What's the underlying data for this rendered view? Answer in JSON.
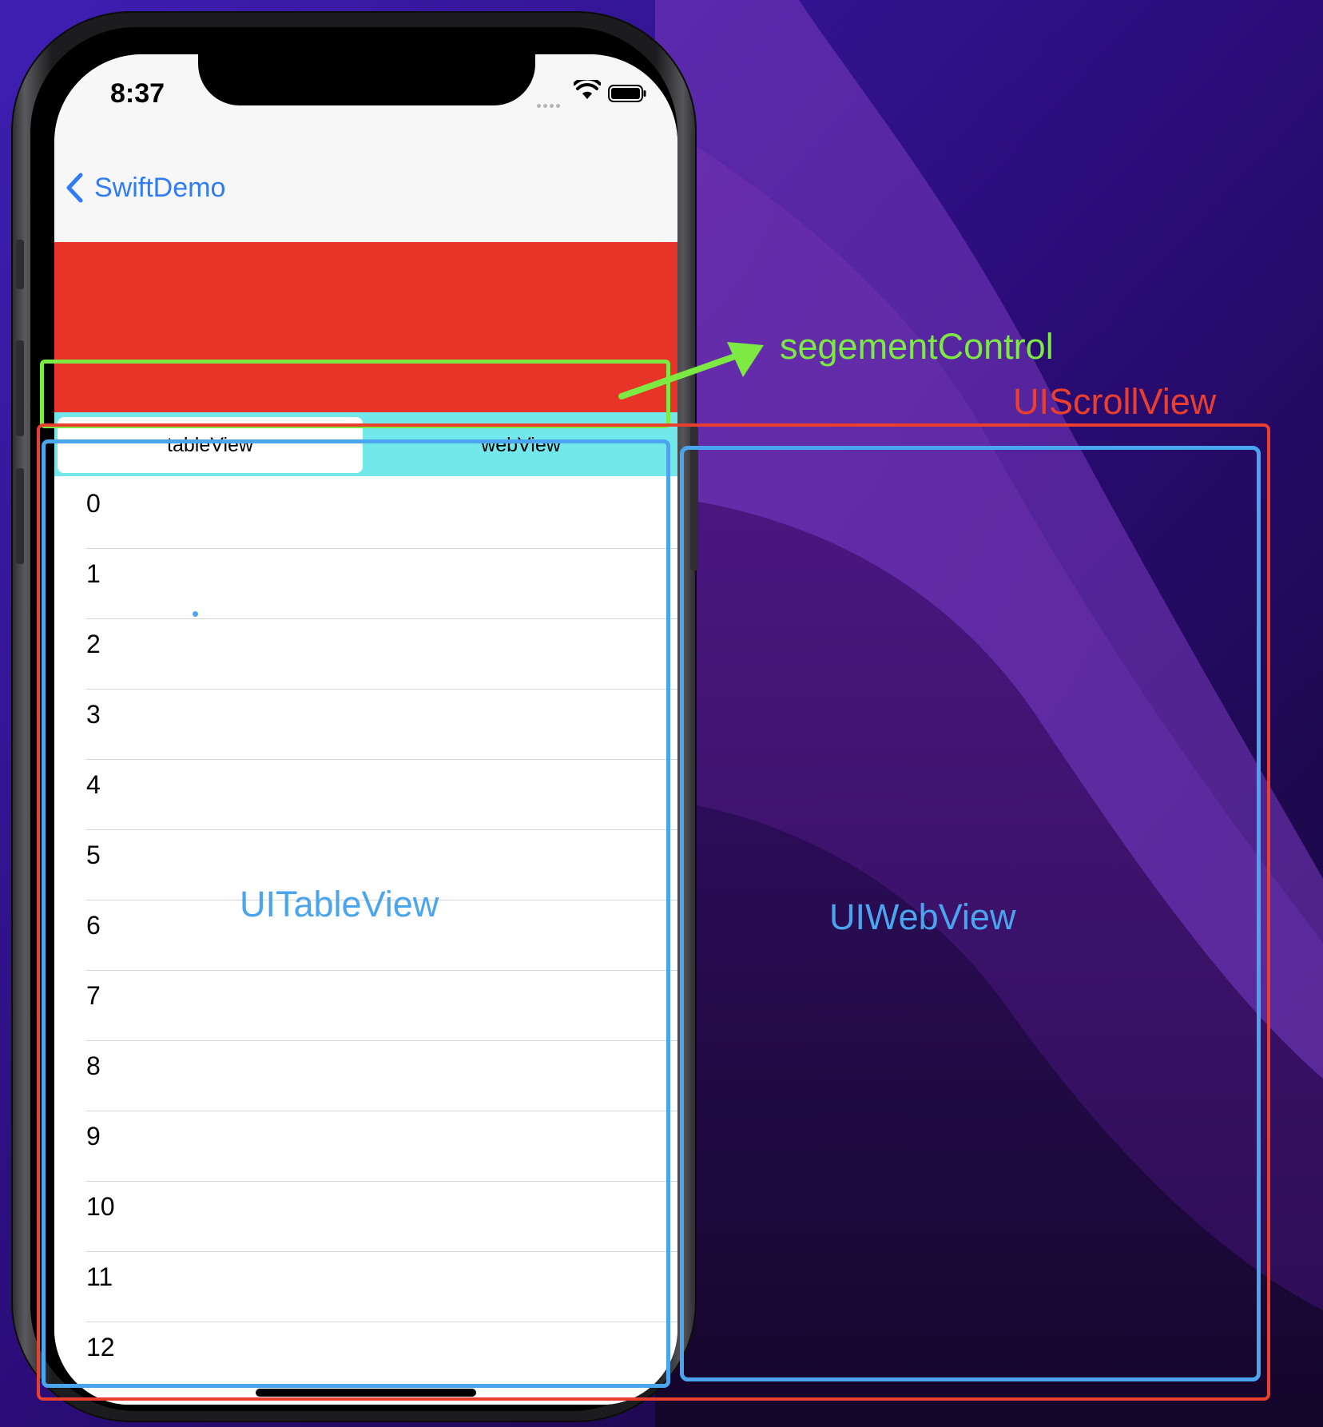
{
  "status_bar": {
    "time": "8:37"
  },
  "nav": {
    "back_label": "SwiftDemo"
  },
  "segmented_control": {
    "items": [
      "tableView",
      "webView"
    ],
    "selected_index": 0
  },
  "table": {
    "rows": [
      "0",
      "1",
      "2",
      "3",
      "4",
      "5",
      "6",
      "7",
      "8",
      "9",
      "10",
      "11",
      "12"
    ]
  },
  "annotations": {
    "segment_label": "segementControl",
    "scroll_label": "UIScrollView",
    "table_label": "UITableView",
    "web_label": "UIWebView"
  },
  "colors": {
    "accent_blue": "#2f7cf6",
    "header_red": "#e83428",
    "segment_bg": "#72e8ea",
    "annotation_green": "#7cea43",
    "annotation_red": "#ea3f2e",
    "annotation_blue": "#4aa5ee"
  }
}
